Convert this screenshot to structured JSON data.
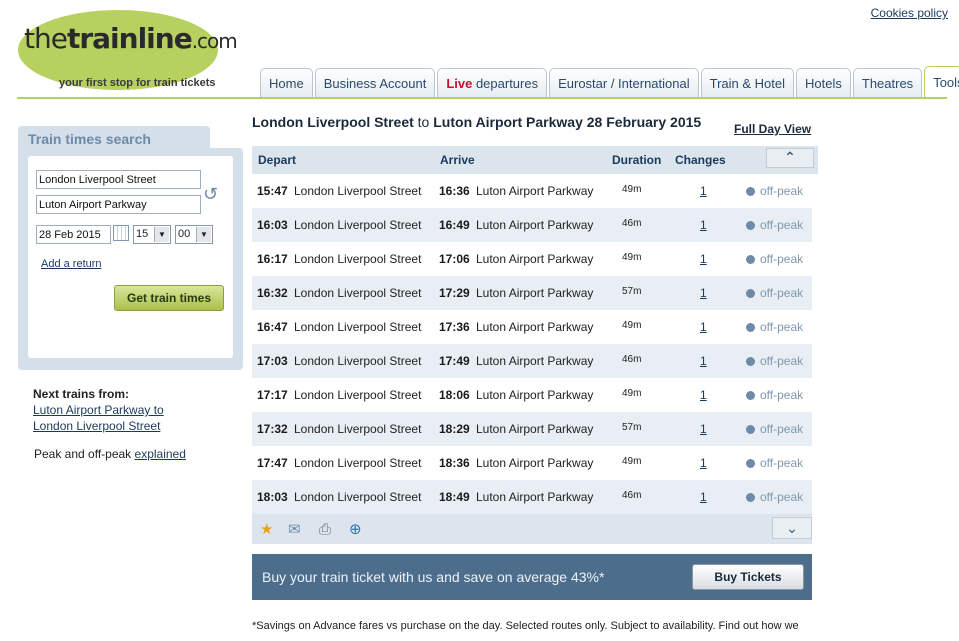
{
  "header": {
    "logo_the": "the",
    "logo_trainline": "trainline",
    "logo_com": ".com",
    "tagline": "your first stop for train tickets",
    "cookies": "Cookies policy"
  },
  "tabs": [
    {
      "label": "Home"
    },
    {
      "label": "Business Account"
    },
    {
      "live": "Live",
      "label": " departures"
    },
    {
      "label": "Eurostar / International"
    },
    {
      "label": "Train & Hotel"
    },
    {
      "label": "Hotels"
    },
    {
      "label": "Theatres"
    },
    {
      "label": "Tools"
    }
  ],
  "sidebar": {
    "title": "Train times search",
    "from": "London Liverpool Street",
    "to": "Luton Airport Parkway",
    "date": "28 Feb 2015",
    "hour": "15",
    "minute": "00",
    "add_return": "Add a return",
    "get_times": "Get train times",
    "next_title": "Next trains from:",
    "next_link_line1": "Luton Airport Parkway to",
    "next_link_line2": "London Liverpool Street",
    "peak_text": "Peak and off-peak ",
    "peak_link": "explained"
  },
  "main": {
    "origin": "London Liverpool Street",
    "to_word": " to ",
    "destination": "Luton Airport Parkway",
    "date": " 28 February 2015",
    "full_day_view": "Full Day View",
    "headers": {
      "depart": "Depart",
      "arrive": "Arrive",
      "duration": "Duration",
      "changes": "Changes"
    },
    "rows": [
      {
        "dep": "15:47",
        "from": "London Liverpool Street",
        "arr": "16:36",
        "to": "Luton Airport Parkway",
        "dur": "49m",
        "chg": "1",
        "fare": "off-peak"
      },
      {
        "dep": "16:03",
        "from": "London Liverpool Street",
        "arr": "16:49",
        "to": "Luton Airport Parkway",
        "dur": "46m",
        "chg": "1",
        "fare": "off-peak"
      },
      {
        "dep": "16:17",
        "from": "London Liverpool Street",
        "arr": "17:06",
        "to": "Luton Airport Parkway",
        "dur": "49m",
        "chg": "1",
        "fare": "off-peak"
      },
      {
        "dep": "16:32",
        "from": "London Liverpool Street",
        "arr": "17:29",
        "to": "Luton Airport Parkway",
        "dur": "57m",
        "chg": "1",
        "fare": "off-peak"
      },
      {
        "dep": "16:47",
        "from": "London Liverpool Street",
        "arr": "17:36",
        "to": "Luton Airport Parkway",
        "dur": "49m",
        "chg": "1",
        "fare": "off-peak"
      },
      {
        "dep": "17:03",
        "from": "London Liverpool Street",
        "arr": "17:49",
        "to": "Luton Airport Parkway",
        "dur": "46m",
        "chg": "1",
        "fare": "off-peak"
      },
      {
        "dep": "17:17",
        "from": "London Liverpool Street",
        "arr": "18:06",
        "to": "Luton Airport Parkway",
        "dur": "49m",
        "chg": "1",
        "fare": "off-peak"
      },
      {
        "dep": "17:32",
        "from": "London Liverpool Street",
        "arr": "18:29",
        "to": "Luton Airport Parkway",
        "dur": "57m",
        "chg": "1",
        "fare": "off-peak"
      },
      {
        "dep": "17:47",
        "from": "London Liverpool Street",
        "arr": "18:36",
        "to": "Luton Airport Parkway",
        "dur": "49m",
        "chg": "1",
        "fare": "off-peak"
      },
      {
        "dep": "18:03",
        "from": "London Liverpool Street",
        "arr": "18:49",
        "to": "Luton Airport Parkway",
        "dur": "46m",
        "chg": "1",
        "fare": "off-peak"
      }
    ],
    "icons": [
      "star-icon",
      "mail-icon",
      "print-icon",
      "plus-icon"
    ],
    "banner_text": "Buy your train ticket with us and save on average 43%*",
    "buy_tickets": "Buy Tickets",
    "footnote": "*Savings on Advance fares vs purchase on the day. Selected routes only. Subject to availability. Find out how we"
  },
  "colors": {
    "brand_green": "#b7d160",
    "nav_blue": "#1a3a5c",
    "row_alt": "#e8eef4",
    "banner": "#4d6d8c",
    "live_red": "#c8102e"
  }
}
